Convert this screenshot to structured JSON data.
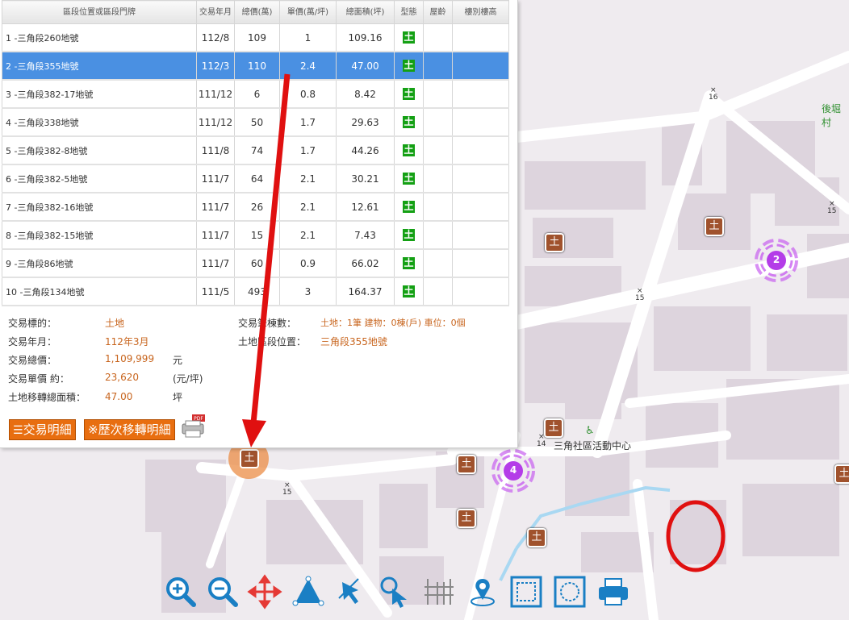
{
  "table": {
    "headers": [
      "區段位置或區段門牌",
      "交易年月",
      "總價(萬)",
      "單價(萬/坪)",
      "總面積(坪)",
      "型態",
      "屋齡",
      "樓別樓高"
    ],
    "rows": [
      {
        "location": "1 -三角段260地號",
        "date": "112/8",
        "total": "109",
        "unit": "1",
        "area": "109.16",
        "type": "土"
      },
      {
        "location": "2 -三角段355地號",
        "date": "112/3",
        "total": "110",
        "unit": "2.4",
        "area": "47.00",
        "type": "土"
      },
      {
        "location": "3 -三角段382-17地號",
        "date": "111/12",
        "total": "6",
        "unit": "0.8",
        "area": "8.42",
        "type": "土"
      },
      {
        "location": "4 -三角段338地號",
        "date": "111/12",
        "total": "50",
        "unit": "1.7",
        "area": "29.63",
        "type": "土"
      },
      {
        "location": "5 -三角段382-8地號",
        "date": "111/8",
        "total": "74",
        "unit": "1.7",
        "area": "44.26",
        "type": "土"
      },
      {
        "location": "6 -三角段382-5地號",
        "date": "111/7",
        "total": "64",
        "unit": "2.1",
        "area": "30.21",
        "type": "土"
      },
      {
        "location": "7 -三角段382-16地號",
        "date": "111/7",
        "total": "26",
        "unit": "2.1",
        "area": "12.61",
        "type": "土"
      },
      {
        "location": "8 -三角段382-15地號",
        "date": "111/7",
        "total": "15",
        "unit": "2.1",
        "area": "7.43",
        "type": "土"
      },
      {
        "location": "9 -三角段86地號",
        "date": "111/7",
        "total": "60",
        "unit": "0.9",
        "area": "66.02",
        "type": "土"
      },
      {
        "location": "10 -三角段134地號",
        "date": "111/5",
        "total": "493",
        "unit": "3",
        "area": "164.37",
        "type": "土"
      }
    ]
  },
  "details": {
    "target_label": "交易標的：",
    "target_value": "土地",
    "date_label": "交易年月：",
    "date_value": "112年3月",
    "total_label": "交易總價：",
    "total_value": "1,109,999",
    "total_unit": "元",
    "unit_label": "交易單價 約：",
    "unit_value": "23,620",
    "unit_unit": "(元/坪)",
    "area_label": "土地移轉總面積：",
    "area_value": "47.00",
    "area_unit": "坪",
    "count_label": "交易筆棟數：",
    "count_value": "土地：1筆 建物：0棟(戶) 車位：0個",
    "pos_label": "土地區段位置：",
    "pos_value": "三角段355地號"
  },
  "buttons": {
    "detail": "交易明細",
    "history": "※歷次移轉明細"
  },
  "map": {
    "labels": {
      "village": "後堀村",
      "community": "三角社區活動中心"
    },
    "cluster_a": "2",
    "cluster_b": "4",
    "marker": "土",
    "elev": [
      "16",
      "15",
      "15",
      "15",
      "14"
    ]
  },
  "colors": {
    "selected": "#4a90e2",
    "accent": "#c8651e",
    "button": "#e86e10",
    "cluster": "#b43ce8",
    "arrow": "#e01010"
  }
}
